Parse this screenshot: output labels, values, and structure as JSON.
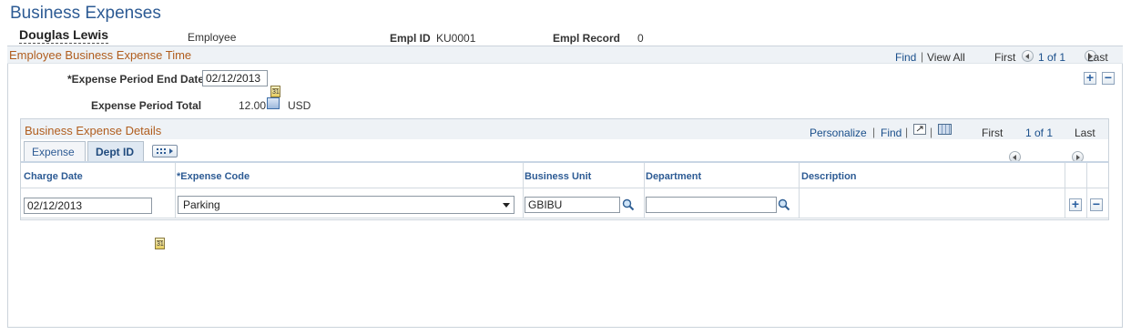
{
  "page_title": "Business Expenses",
  "employee": {
    "name": "Douglas Lewis",
    "role": "Employee",
    "empl_id_label": "Empl ID",
    "empl_id": "KU0001",
    "empl_record_label": "Empl Record",
    "empl_record": "0"
  },
  "outer_section": {
    "title": "Employee Business Expense Time",
    "find": "Find",
    "view_all": "View All",
    "first": "First",
    "count": "1 of 1",
    "last": "Last",
    "period_end_label": "*Expense Period End Date",
    "period_end_value": "02/12/2013",
    "period_total_label": "Expense Period Total",
    "period_total_value": "12.00",
    "currency": "USD"
  },
  "inner_section": {
    "title": "Business Expense Details",
    "personalize": "Personalize",
    "find": "Find",
    "first": "First",
    "count": "1 of 1",
    "last": "Last",
    "tabs": [
      {
        "label": "Expense",
        "active": false
      },
      {
        "label": "Dept ID",
        "active": true
      }
    ],
    "columns": [
      "Charge Date",
      "*Expense Code",
      "Business Unit",
      "Department",
      "Description"
    ],
    "rows": [
      {
        "charge_date": "02/12/2013",
        "expense_code": "Parking",
        "business_unit": "GBIBU",
        "department": "",
        "description": ""
      }
    ]
  },
  "colors": {
    "title_blue": "#2d5b94",
    "section_orange": "#b05d1e",
    "link_blue": "#1a4f8b"
  }
}
